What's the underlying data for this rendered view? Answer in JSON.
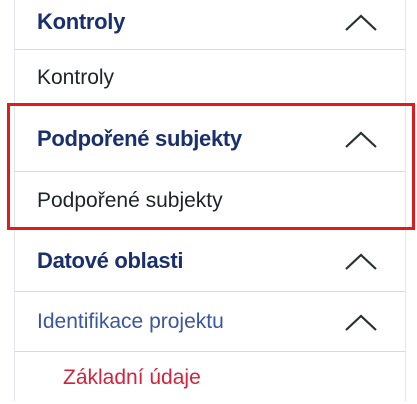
{
  "sections": [
    {
      "header": "Kontroly",
      "item": "Kontroly",
      "expanded": true
    },
    {
      "header": "Podpořené subjekty",
      "item": "Podpořené subjekty",
      "expanded": true
    },
    {
      "header": "Datové oblasti",
      "expanded": true
    },
    {
      "subheader": "Identifikace projektu",
      "expanded": true,
      "link": "Základní údaje"
    }
  ],
  "icons": {
    "chevron": "chevron-up-icon"
  },
  "colors": {
    "header_text": "#1a2f6e",
    "sub_text": "#3a55a3",
    "link_text": "#d2233e",
    "highlight_border": "#e01b1b"
  }
}
